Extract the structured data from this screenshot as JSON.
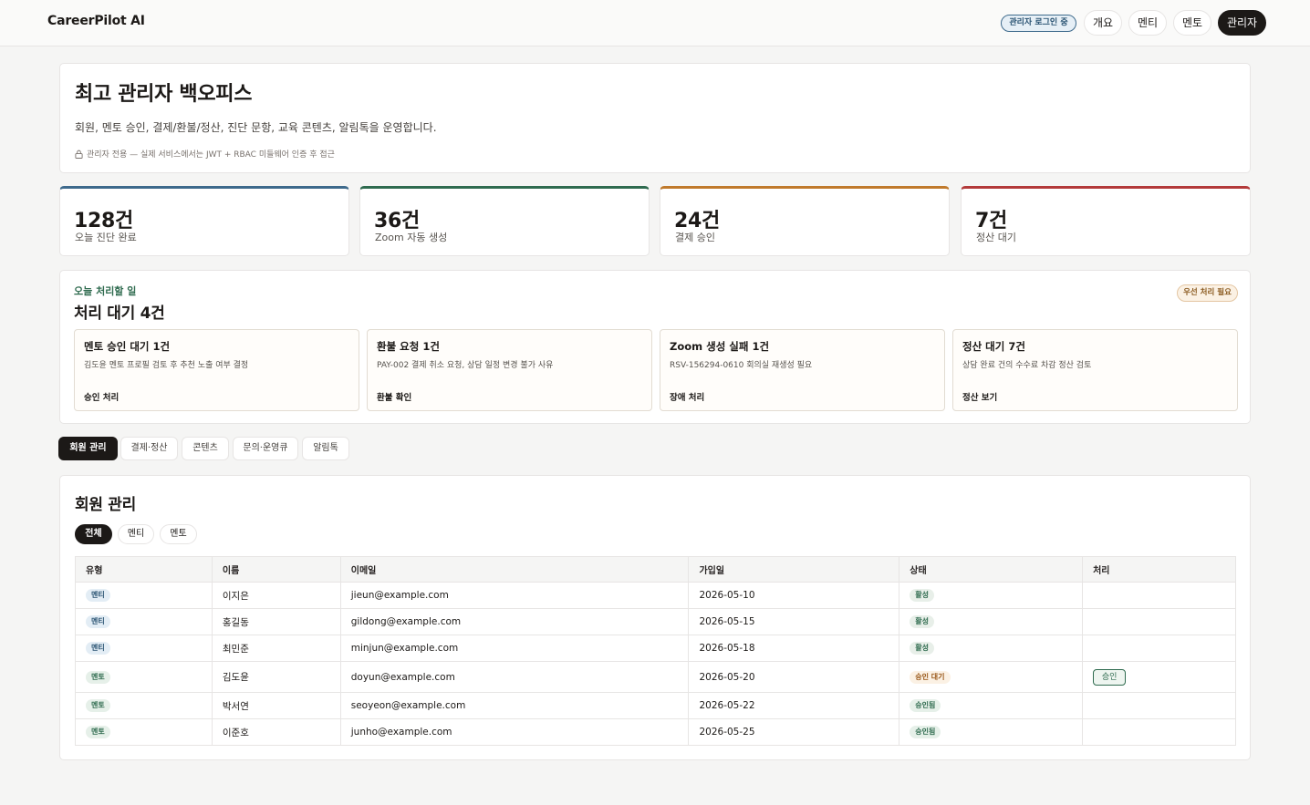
{
  "brand": "CareerPilot AI",
  "header": {
    "status_badge": "관리자 로그인 중",
    "nav": [
      "개요",
      "멘티",
      "멘토",
      "관리자"
    ]
  },
  "hero": {
    "title": "최고 관리자 백오피스",
    "subtitle": "회원, 멘토 승인, 결제/환불/정산, 진단 문항, 교육 콘텐츠, 알림톡을 운영합니다.",
    "note": "관리자 전용 — 실제 서비스에서는 JWT + RBAC 미들웨어 인증 후 접근"
  },
  "stats": [
    {
      "value": "128건",
      "label": "오늘 진단 완료",
      "color": "#3e6a8c"
    },
    {
      "value": "36건",
      "label": "Zoom 자동 생성",
      "color": "#2f6b4f"
    },
    {
      "value": "24건",
      "label": "결제 승인",
      "color": "#c07a2c"
    },
    {
      "value": "7건",
      "label": "정산 대기",
      "color": "#b33a3a"
    }
  ],
  "todo": {
    "kicker": "오늘 처리할 일",
    "title": "처리 대기 4건",
    "priority": "우선 처리 필요",
    "tasks": [
      {
        "title": "멘토 승인 대기 1건",
        "desc": "김도윤 멘토 프로필 검토 후 추천 노출 여부 결정",
        "action": "승인 처리"
      },
      {
        "title": "환불 요청 1건",
        "desc": "PAY-002 결제 취소 요청, 상담 일정 변경 불가 사유",
        "action": "환불 확인"
      },
      {
        "title": "Zoom 생성 실패 1건",
        "desc": "RSV-156294-0610 회의실 재생성 필요",
        "action": "장애 처리"
      },
      {
        "title": "정산 대기 7건",
        "desc": "상담 완료 건의 수수료 차감 정산 검토",
        "action": "정산 보기"
      }
    ]
  },
  "tabs": [
    "회원 관리",
    "결제·정산",
    "콘텐츠",
    "문의·운영큐",
    "알림톡"
  ],
  "members": {
    "title": "회원 관리",
    "filters": [
      "전체",
      "멘티",
      "멘토"
    ],
    "columns": [
      "유형",
      "이름",
      "이메일",
      "가입일",
      "상태",
      "처리"
    ],
    "rows": [
      {
        "type": "멘티",
        "name": "이지은",
        "email": "jieun@example.com",
        "joined": "2026-05-10",
        "status": "활성",
        "action": ""
      },
      {
        "type": "멘티",
        "name": "홍길동",
        "email": "gildong@example.com",
        "joined": "2026-05-15",
        "status": "활성",
        "action": ""
      },
      {
        "type": "멘티",
        "name": "최민준",
        "email": "minjun@example.com",
        "joined": "2026-05-18",
        "status": "활성",
        "action": ""
      },
      {
        "type": "멘토",
        "name": "김도윤",
        "email": "doyun@example.com",
        "joined": "2026-05-20",
        "status": "승인 대기",
        "action": "승인"
      },
      {
        "type": "멘토",
        "name": "박서연",
        "email": "seoyeon@example.com",
        "joined": "2026-05-22",
        "status": "승인됨",
        "action": ""
      },
      {
        "type": "멘토",
        "name": "이준호",
        "email": "junho@example.com",
        "joined": "2026-05-25",
        "status": "승인됨",
        "action": ""
      }
    ]
  }
}
